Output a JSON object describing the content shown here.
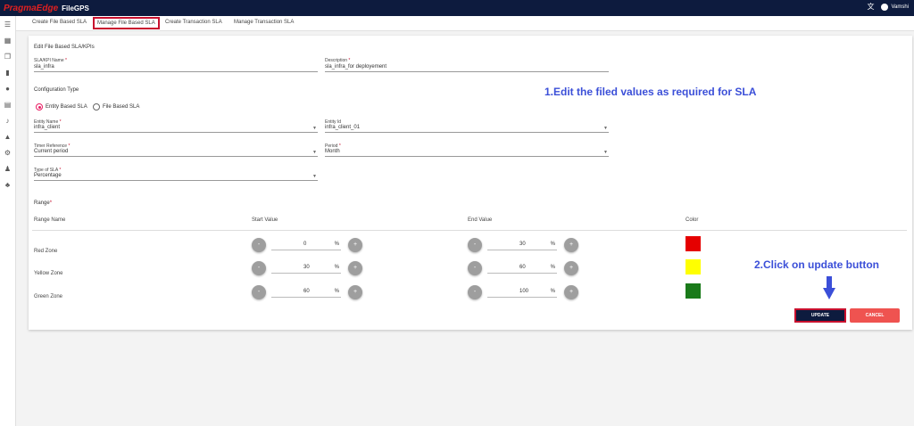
{
  "header": {
    "brand": "PragmaEdge",
    "app_name": "FileGPS",
    "user": "Vamshi",
    "translate_icon": "translate-icon",
    "user_icon": "account-circle-icon"
  },
  "sidebar": {
    "icons": [
      "menu-icon",
      "dashboard-icon",
      "files-icon",
      "bar-chart-icon",
      "account-icon",
      "document-icon",
      "bell-icon",
      "alert-icon",
      "settings-icon",
      "admin-icon",
      "group-icon"
    ]
  },
  "tabs": [
    "Create File Based SLA",
    "Manage File Based SLA",
    "Create Transaction SLA",
    "Manage Transaction SLA"
  ],
  "active_tab": "Manage File Based SLA",
  "form": {
    "title": "Edit File Based SLA/KPIs",
    "sla_name_label": "SLA/KPI Name",
    "sla_name_value": "sla_infra",
    "description_label": "Description",
    "description_value": "sla_infra_for deployement",
    "config_type_label": "Configuration Type",
    "radio_entity": "Entity Based SLA",
    "radio_file": "File Based SLA",
    "entity_name_label": "Entity Name",
    "entity_name_value": "infra_client",
    "entity_id_label": "Entity Id",
    "entity_id_value": "infra_client_01",
    "timer_ref_label": "Timer Reference",
    "timer_ref_value": "Current period",
    "period_label": "Period",
    "period_value": "Month",
    "type_label": "Type of SLA",
    "type_value": "Percentage",
    "required_mark": "*"
  },
  "range": {
    "title": "Range",
    "headers": {
      "name": "Range Name",
      "start": "Start Value",
      "end": "End Value",
      "color": "Color"
    },
    "minus": "-",
    "plus": "+",
    "unit": "%",
    "rows": [
      {
        "name": "Red Zone",
        "start": "0",
        "end": "30",
        "color": "#e50000"
      },
      {
        "name": "Yellow Zone",
        "start": "30",
        "end": "60",
        "color": "#ffff00"
      },
      {
        "name": "Green Zone",
        "start": "60",
        "end": "100",
        "color": "#1a7a1a"
      }
    ]
  },
  "buttons": {
    "update": "UPDATE",
    "cancel": "CANCEL"
  },
  "annotations": {
    "step1": "1.Edit the filed values as required for SLA",
    "step2": "2.Click on update button"
  }
}
